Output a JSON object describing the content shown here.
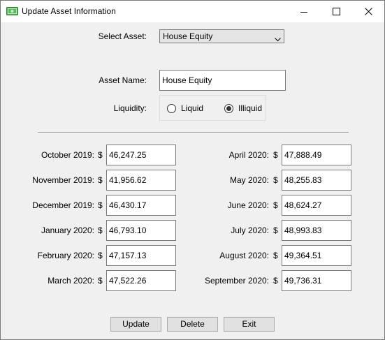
{
  "window": {
    "title": "Update Asset Information"
  },
  "icons": {
    "app": "money-icon",
    "minimize": "minimize-icon",
    "maximize": "maximize-icon",
    "close": "close-icon",
    "dropdown": "chevron-down-icon"
  },
  "colors": {
    "app_icon_green": "#4caf50",
    "window_background": "#f0f0f0",
    "titlebar_background": "#ffffff"
  },
  "select_asset": {
    "label": "Select Asset:",
    "value": "House Equity"
  },
  "asset_name": {
    "label": "Asset Name:",
    "value": "House Equity"
  },
  "liquidity": {
    "label": "Liquidity:",
    "options": [
      {
        "label": "Liquid",
        "checked": false
      },
      {
        "label": "Illiquid",
        "checked": true
      }
    ]
  },
  "currency_symbol": "$",
  "months_left": [
    {
      "label": "October 2019:",
      "value": "46,247.25"
    },
    {
      "label": "November 2019:",
      "value": "41,956.62"
    },
    {
      "label": "December 2019:",
      "value": "46,430.17"
    },
    {
      "label": "January 2020:",
      "value": "46,793.10"
    },
    {
      "label": "February 2020:",
      "value": "47,157.13"
    },
    {
      "label": "March 2020:",
      "value": "47,522.26"
    }
  ],
  "months_right": [
    {
      "label": "April 2020:",
      "value": "47,888.49"
    },
    {
      "label": "May 2020:",
      "value": "48,255.83"
    },
    {
      "label": "June 2020:",
      "value": "48,624.27"
    },
    {
      "label": "July 2020:",
      "value": "48,993.83"
    },
    {
      "label": "August 2020:",
      "value": "49,364.51"
    },
    {
      "label": "September 2020:",
      "value": "49,736.31"
    }
  ],
  "buttons": {
    "update": "Update",
    "delete": "Delete",
    "exit": "Exit"
  }
}
